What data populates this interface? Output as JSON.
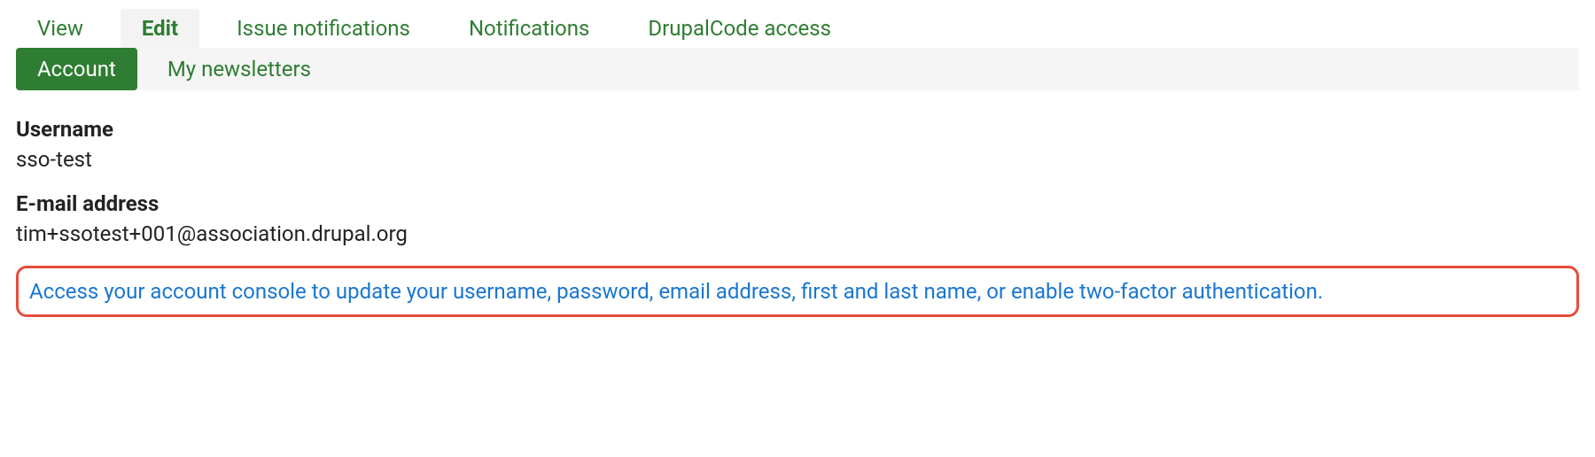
{
  "primary_tabs": {
    "view": "View",
    "edit": "Edit",
    "issue_notifications": "Issue notifications",
    "notifications": "Notifications",
    "drupalcode_access": "DrupalCode access"
  },
  "secondary_tabs": {
    "account": "Account",
    "my_newsletters": "My newsletters"
  },
  "fields": {
    "username_label": "Username",
    "username_value": "sso-test",
    "email_label": "E-mail address",
    "email_value": "tim+ssotest+001@association.drupal.org"
  },
  "console_link_text": "Access your account console to update your username, password, email address, first and last name, or enable two-factor authentication."
}
